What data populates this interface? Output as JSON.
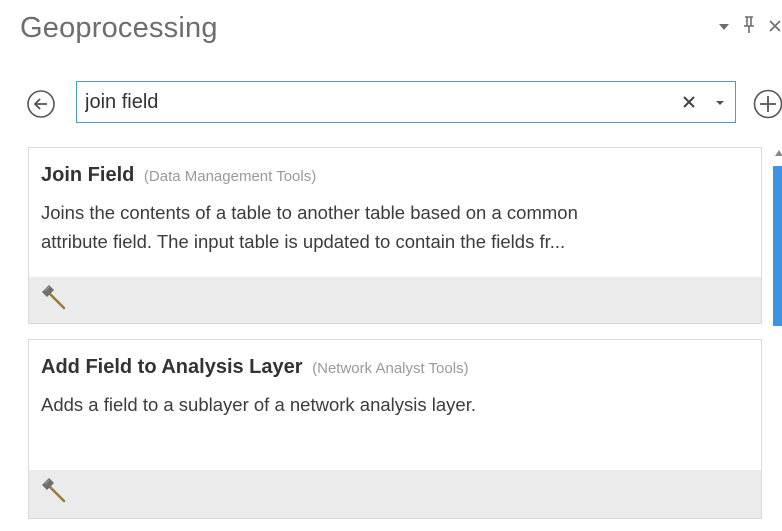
{
  "pane": {
    "title": "Geoprocessing",
    "controls": {
      "menu_icon": "chevron-down-icon",
      "pin_icon": "pin-icon",
      "close_icon": "close-icon"
    }
  },
  "search": {
    "value": "join field",
    "back_icon": "back-arrow-icon",
    "clear_icon": "close-icon",
    "dropdown_icon": "caret-down-icon",
    "add_icon": "add-circle-icon"
  },
  "results": [
    {
      "title_prefix": "",
      "title_match": "Join Field",
      "title_suffix": "",
      "category": "(Data Management Tools)",
      "description": [
        "Joins the contents of a table to another table based on a common",
        "attribute field. The input table is updated to contain the fields fr..."
      ],
      "tool_icon": "hammer-icon"
    },
    {
      "title_prefix": "Add ",
      "title_match": "Field",
      "title_suffix": " to Analysis Layer",
      "category": "(Network Analyst Tools)",
      "description": [
        "Adds a field to a sublayer of a network analysis layer.",
        ""
      ],
      "tool_icon": "hammer-icon"
    }
  ],
  "colors": {
    "accent": "#3c94e4",
    "search_border": "#4a9ad8",
    "card_footer": "#ebebeb"
  }
}
